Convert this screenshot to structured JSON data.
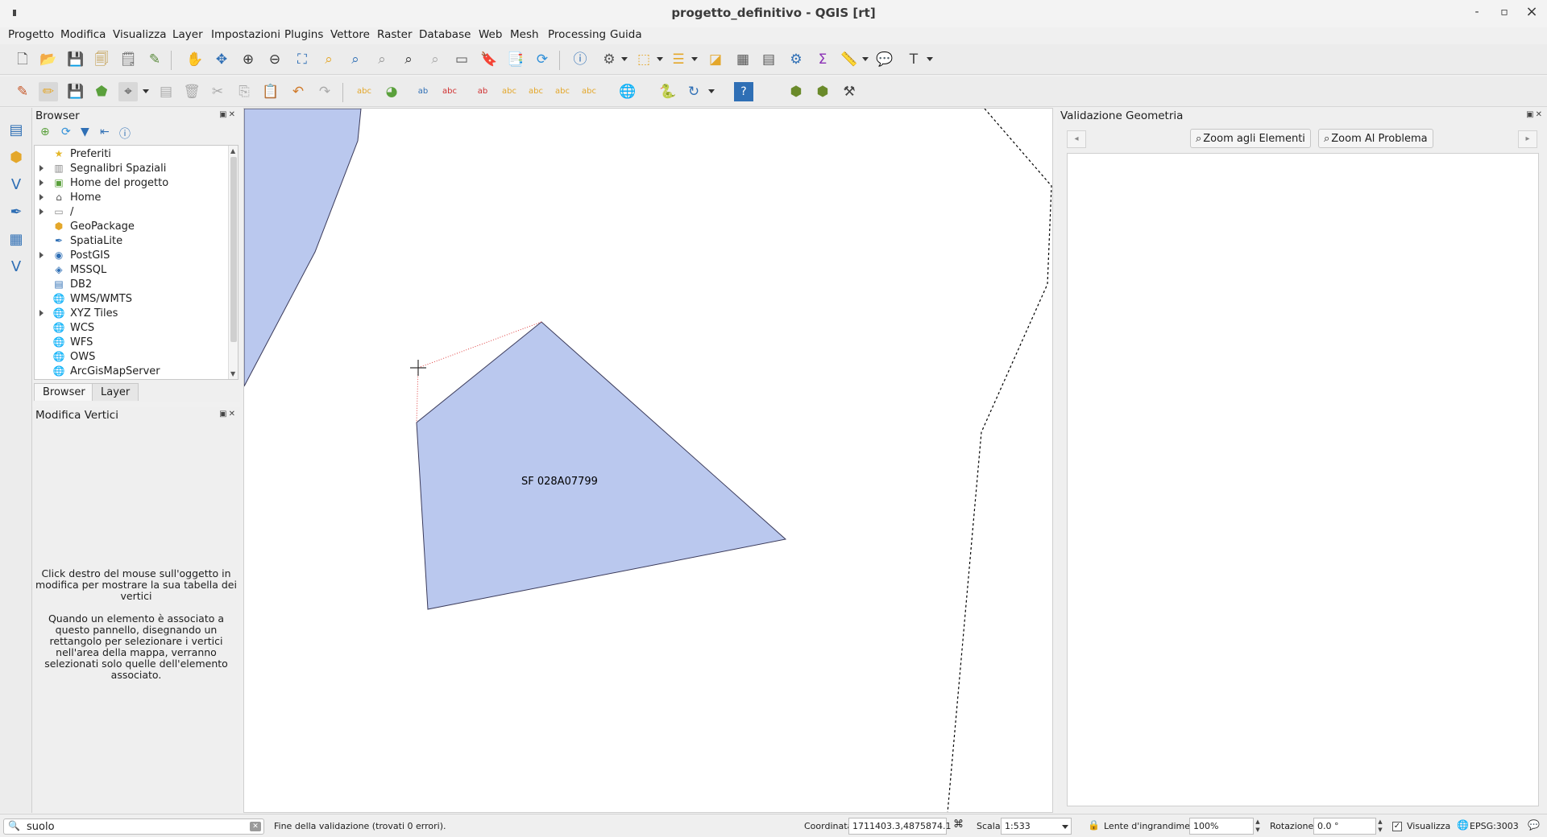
{
  "window": {
    "title": "progetto_definitivo - QGIS [rt]",
    "minimize": "-",
    "maximize": "▫",
    "close": "×"
  },
  "menu": [
    "Progetto",
    "Modifica",
    "Visualizza",
    "Layer",
    "Impostazioni",
    "Plugins",
    "Vettore",
    "Raster",
    "Database",
    "Web",
    "Mesh",
    "Processing",
    "Guida"
  ],
  "browser": {
    "title": "Browser",
    "items": [
      {
        "label": "Preferiti",
        "icon": "star-icon",
        "expand": false
      },
      {
        "label": "Segnalibri Spaziali",
        "icon": "bookmark-icon",
        "expand": true
      },
      {
        "label": "Home del progetto",
        "icon": "project-home-icon",
        "expand": true
      },
      {
        "label": "Home",
        "icon": "home-icon",
        "expand": true
      },
      {
        "label": "/",
        "icon": "folder-icon",
        "expand": true
      },
      {
        "label": "GeoPackage",
        "icon": "geopackage-icon",
        "expand": false
      },
      {
        "label": "SpatiaLite",
        "icon": "spatialite-icon",
        "expand": false
      },
      {
        "label": "PostGIS",
        "icon": "postgis-icon",
        "expand": true
      },
      {
        "label": "MSSQL",
        "icon": "mssql-icon",
        "expand": false
      },
      {
        "label": "DB2",
        "icon": "db2-icon",
        "expand": false
      },
      {
        "label": "WMS/WMTS",
        "icon": "globe-icon",
        "expand": false
      },
      {
        "label": "XYZ Tiles",
        "icon": "globe-icon",
        "expand": true
      },
      {
        "label": "WCS",
        "icon": "globe-icon",
        "expand": false
      },
      {
        "label": "WFS",
        "icon": "globe-icon",
        "expand": false
      },
      {
        "label": "OWS",
        "icon": "globe-icon",
        "expand": false
      },
      {
        "label": "ArcGisMapServer",
        "icon": "globe-icon",
        "expand": false
      }
    ],
    "tabs": [
      "Browser",
      "Layer"
    ]
  },
  "vertex_editor": {
    "title": "Modifica Vertici",
    "help1": "Click destro del mouse sull'oggetto in modifica per mostrare la sua tabella dei vertici",
    "help2": "Quando un elemento è associato a questo pannello, disegnando un rettangolo per selezionare i vertici nell'area della mappa, verranno selezionati solo quelle dell'elemento associato."
  },
  "map": {
    "polygon_label": "SF 028A07799",
    "fill_color": "#bac8ee",
    "stroke_color": "#3a3a5a"
  },
  "validation": {
    "title": "Validazione Geometria",
    "zoom_elements": "Zoom agli Elementi",
    "zoom_problem": "Zoom Al Problema",
    "prev": "◂",
    "next": "▸"
  },
  "status": {
    "search_value": "suolo",
    "message": "Fine della validazione (trovati 0 errori).",
    "coord_label": "Coordinata",
    "coord_value": "1711403.3,4875874.1",
    "scale_label": "Scala",
    "scale_value": "1:533",
    "magnifier_label": "Lente d'ingrandimento",
    "magnifier_value": "100%",
    "rotation_label": "Rotazione",
    "rotation_value": "0.0 °",
    "render_label": "Visualizza",
    "crs": "EPSG:3003"
  }
}
